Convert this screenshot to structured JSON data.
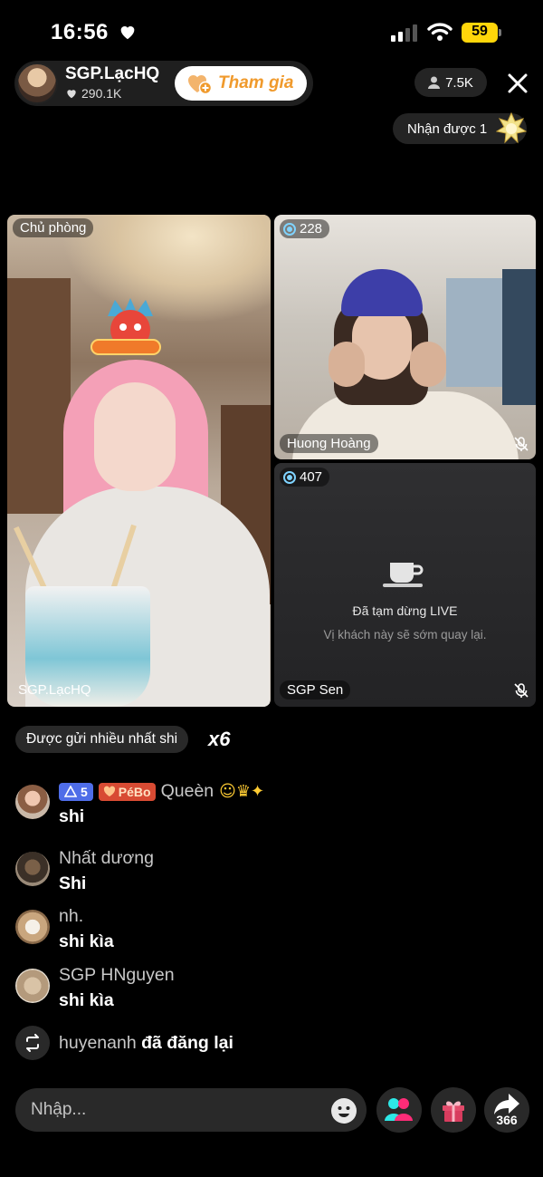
{
  "status_bar": {
    "time": "16:56",
    "battery": "59"
  },
  "host": {
    "name": "SGP.LạcHQ",
    "likes": "290.1K",
    "join_label": "Tham gia"
  },
  "viewers": {
    "count": "7.5K"
  },
  "received": {
    "label": "Nhận được 1"
  },
  "tiles": {
    "host": {
      "top_label": "Chủ phòng",
      "name": "SGP.LạcHQ"
    },
    "guest1": {
      "count": "228",
      "name": "Huong Hoàng"
    },
    "guest2": {
      "count": "407",
      "name": "SGP Sen",
      "paused_title": "Đã tạm dừng LIVE",
      "paused_sub": "Vị khách này sẽ sớm quay lại."
    }
  },
  "most_sent": {
    "label": "Được gửi nhiều nhất shi",
    "multiplier": "x6"
  },
  "comments": [
    {
      "user": "Queèn",
      "level": "5",
      "fan_badge": "PéBo",
      "text": "shi"
    },
    {
      "user": "Nhất dương",
      "text": "Shi"
    },
    {
      "user": "nh.",
      "text": "shi kìa"
    },
    {
      "user": "SGP HNguyen",
      "text": "shi kìa"
    }
  ],
  "repost": {
    "user": "huyenanh",
    "action": "đã đăng lại"
  },
  "bottom_bar": {
    "input_placeholder": "Nhập...",
    "share_count": "366"
  },
  "colors": {
    "join_accent": "#f09a2c",
    "level_badge": "#4f6de8",
    "fan_badge": "#d84b33",
    "battery": "#ffd60a"
  }
}
